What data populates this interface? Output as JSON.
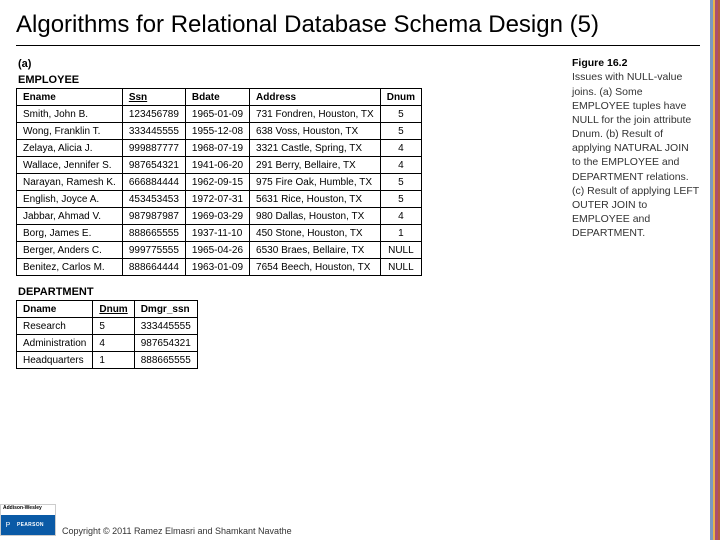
{
  "title": "Algorithms for Relational Database Schema Design (5)",
  "figure": {
    "part_label": "(a)",
    "employee": {
      "name": "EMPLOYEE",
      "headers": [
        "Ename",
        "Ssn",
        "Bdate",
        "Address",
        "Dnum"
      ],
      "key_cols": [
        1
      ],
      "rows": [
        [
          "Smith, John B.",
          "123456789",
          "1965-01-09",
          "731 Fondren, Houston, TX",
          "5"
        ],
        [
          "Wong, Franklin T.",
          "333445555",
          "1955-12-08",
          "638 Voss, Houston, TX",
          "5"
        ],
        [
          "Zelaya, Alicia J.",
          "999887777",
          "1968-07-19",
          "3321 Castle, Spring, TX",
          "4"
        ],
        [
          "Wallace, Jennifer S.",
          "987654321",
          "1941-06-20",
          "291 Berry, Bellaire, TX",
          "4"
        ],
        [
          "Narayan, Ramesh K.",
          "666884444",
          "1962-09-15",
          "975 Fire Oak, Humble, TX",
          "5"
        ],
        [
          "English, Joyce A.",
          "453453453",
          "1972-07-31",
          "5631 Rice, Houston, TX",
          "5"
        ],
        [
          "Jabbar, Ahmad V.",
          "987987987",
          "1969-03-29",
          "980 Dallas, Houston, TX",
          "4"
        ],
        [
          "Borg, James E.",
          "888665555",
          "1937-11-10",
          "450 Stone, Houston, TX",
          "1"
        ],
        [
          "Berger, Anders C.",
          "999775555",
          "1965-04-26",
          "6530 Braes, Bellaire, TX",
          "NULL"
        ],
        [
          "Benitez, Carlos M.",
          "888664444",
          "1963-01-09",
          "7654 Beech, Houston, TX",
          "NULL"
        ]
      ]
    },
    "department": {
      "name": "DEPARTMENT",
      "headers": [
        "Dname",
        "Dnum",
        "Dmgr_ssn"
      ],
      "key_cols": [
        1
      ],
      "rows": [
        [
          "Research",
          "5",
          "333445555"
        ],
        [
          "Administration",
          "4",
          "987654321"
        ],
        [
          "Headquarters",
          "1",
          "888665555"
        ]
      ]
    }
  },
  "caption": {
    "fig_num": "Figure 16.2",
    "text": "Issues with NULL-value joins. (a) Some EMPLOYEE tuples have NULL for the join attribute Dnum. (b) Result of applying NATURAL JOIN to the EMPLOYEE and DEPARTMENT relations. (c) Result of applying LEFT OUTER JOIN to EMPLOYEE and DEPARTMENT."
  },
  "footer": {
    "publisher_top": "Addison-Wesley",
    "publisher_sub": "is an imprint of",
    "publisher_name": "PEARSON",
    "copyright": "Copyright © 2011 Ramez Elmasri and Shamkant Navathe"
  }
}
